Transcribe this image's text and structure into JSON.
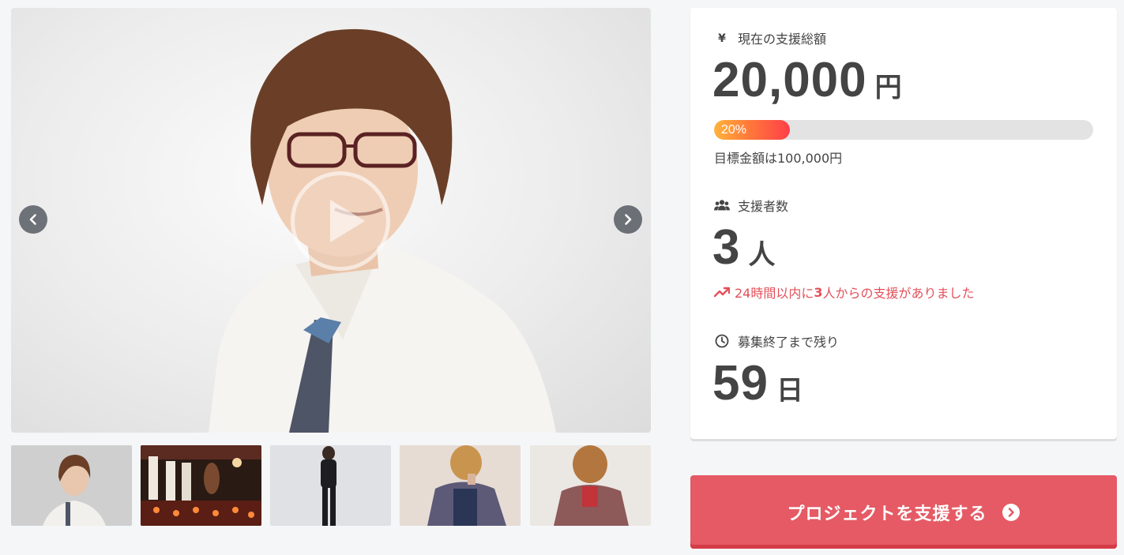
{
  "gallery": {
    "main_media_alt": "",
    "prev_icon": "chevron-left-icon",
    "next_icon": "chevron-right-icon",
    "play_icon": "play-icon",
    "thumbnail_count": 5
  },
  "funding": {
    "label": "現在の支援総額",
    "amount": "20,000",
    "unit": "円",
    "progress_percent": 20,
    "progress_label": "20%",
    "goal_text": "目標金額は100,000円"
  },
  "supporters": {
    "label": "支援者数",
    "count": "3",
    "unit": "人",
    "trend_prefix": "24時間以内に",
    "trend_count": "3",
    "trend_suffix": "人からの支援がありました"
  },
  "deadline": {
    "label": "募集終了まで残り",
    "days": "59",
    "unit": "日"
  },
  "cta": {
    "label": "プロジェクトを支援する"
  },
  "colors": {
    "accent": "#e55a64",
    "trend": "#e3505a",
    "progress_start": "#ffb43c",
    "progress_end": "#ff3f48",
    "text": "#444444"
  }
}
